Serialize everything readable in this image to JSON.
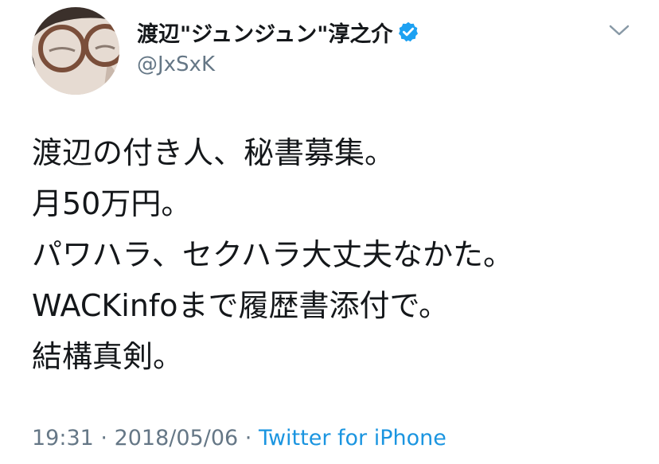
{
  "tweet": {
    "author": {
      "display_name": "渡辺\"ジュンジュン\"淳之介",
      "handle": "@JxSxK",
      "verified": true
    },
    "body_lines": [
      "渡辺の付き人、秘書募集。",
      "月50万円。",
      "パワハラ、セクハラ大丈夫なかた。",
      "WACKinfoまで履歴書添付で。",
      "結構真剣。"
    ],
    "meta": {
      "time": "19:31",
      "separator": " · ",
      "date": "2018/05/06",
      "source": "Twitter for iPhone"
    }
  },
  "icons": {
    "verified": "verified-badge-icon",
    "menu": "chevron-down-icon"
  },
  "colors": {
    "text": "#14171a",
    "secondary": "#657786",
    "link": "#1b95e0",
    "verified": "#1da1f2"
  }
}
